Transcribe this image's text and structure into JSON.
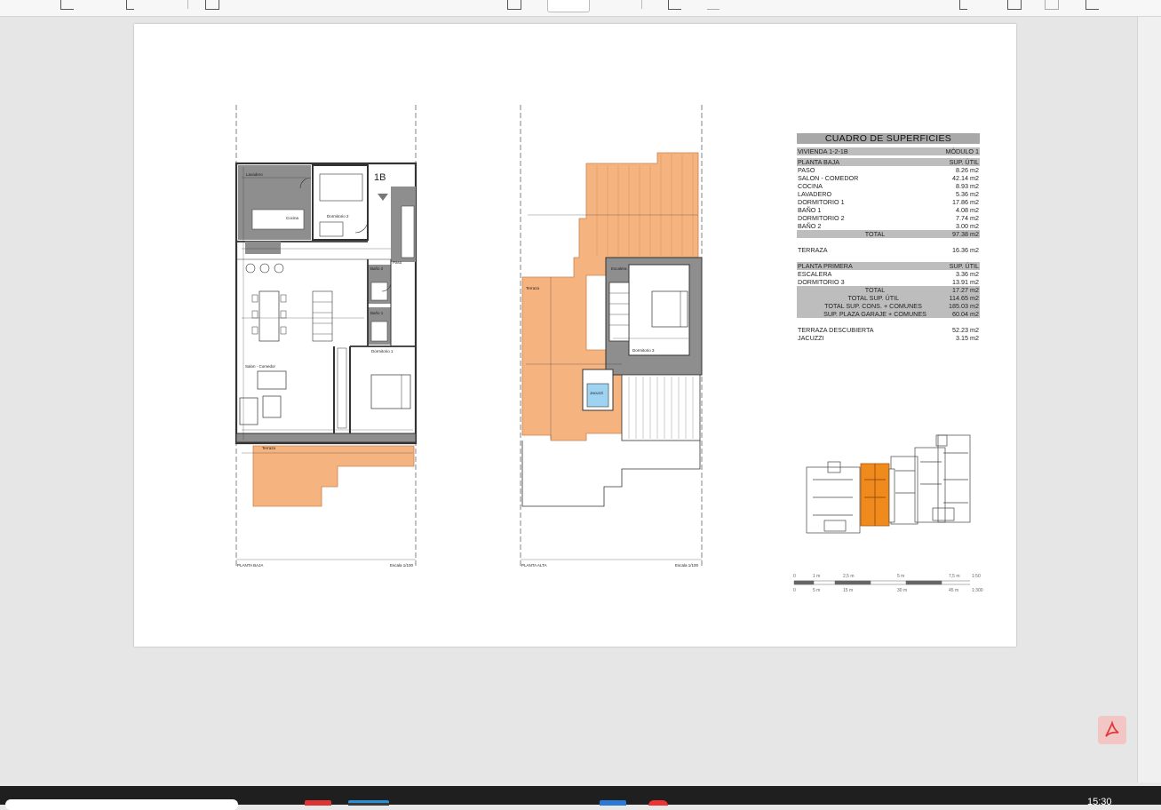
{
  "viewer": {
    "page_number": "",
    "colors": {
      "terrace": "#f5b47f",
      "wall": "#8e8e8e",
      "page": "#ffffff",
      "background": "#e6e6e6"
    }
  },
  "toolbar": {
    "icons": [
      "draw-icon",
      "highlight-icon",
      "comment-icon",
      "fit-page-icon",
      "rotate-icon",
      "link-icon",
      "search-icon",
      "save-icon",
      "print-icon",
      "share-icon"
    ]
  },
  "plans": {
    "ground": {
      "unit_label": "1B",
      "caption": "PLANTA BAJA",
      "scale": "Escala 1/100",
      "rooms": {
        "lavadero": "Lavadero",
        "cocina": "Cocina",
        "dormitorio2": "Dormitorio 2",
        "salon": "Salon - Comedor",
        "bano2": "Baño 2",
        "bano1": "Baño 1",
        "dormitorio1": "Dormitorio 1",
        "paso": "Paso",
        "terraza": "Terraza"
      }
    },
    "upper": {
      "caption": "PLANTA ALTA",
      "scale": "Escala 1/100",
      "rooms": {
        "terraza": "Terraza",
        "escalera": "Escalera",
        "dormitorio3": "Dormitorio 3",
        "jacuzzi": "Jacuzzi"
      }
    }
  },
  "table": {
    "title": "CUADRO DE SUPERFICIES",
    "vivienda": "VIVIENDA 1-2-1B",
    "modulo": "MÓDULO 1",
    "planta_baja": {
      "header": "PLANTA BAJA",
      "col": "SUP. ÚTIL"
    },
    "rows_baja": [
      {
        "name": "PASO",
        "value": "8.26 m2"
      },
      {
        "name": "SALON - COMEDOR",
        "value": "42.14 m2"
      },
      {
        "name": "COCINA",
        "value": "8.93 m2"
      },
      {
        "name": "LAVADERO",
        "value": "5.36 m2"
      },
      {
        "name": "DORMITORIO 1",
        "value": "17.86 m2"
      },
      {
        "name": "BAÑO 1",
        "value": "4.08 m2"
      },
      {
        "name": "DORMITORIO 2",
        "value": "7.74 m2"
      },
      {
        "name": "BAÑO 2",
        "value": "3.00 m2"
      }
    ],
    "total_baja": {
      "name": "TOTAL",
      "value": "97.38 m2"
    },
    "terraza": {
      "name": "TERRAZA",
      "value": "16.36 m2"
    },
    "planta_primera": {
      "header": "PLANTA PRIMERA",
      "col": "SUP. ÚTIL"
    },
    "rows_primera": [
      {
        "name": "ESCALERA",
        "value": "3.36 m2"
      },
      {
        "name": "DORMITORIO 3",
        "value": "13.91 m2"
      }
    ],
    "totals": [
      {
        "name": "TOTAL",
        "value": "17.27 m2"
      },
      {
        "name": "TOTAL SUP. ÚTIL",
        "value": "114.65 m2"
      },
      {
        "name": "TOTAL SUP. CONS. + COMUNES",
        "value": "185.03 m2"
      },
      {
        "name": "SUP. PLAZA GARAJE + COMUNES",
        "value": "60.04 m2"
      }
    ],
    "extras": [
      {
        "name": "TERRAZA DESCUBIERTA",
        "value": "52.23 m2"
      },
      {
        "name": "JACUZZI",
        "value": "3.15 m2"
      }
    ]
  },
  "scale_bar": {
    "top_ticks": [
      "0",
      "1 m",
      "2,5 m",
      "5 m",
      "7,5 m"
    ],
    "top_scale": "1:50",
    "bottom_ticks": [
      "0",
      "5 m",
      "15 m",
      "30 m",
      "45 m"
    ],
    "bottom_scale": "1:300"
  },
  "taskbar": {
    "clock": "15:30",
    "app_colors": [
      "#d33",
      "#2a8fd6",
      "#2a7ad6",
      "#e33"
    ]
  }
}
